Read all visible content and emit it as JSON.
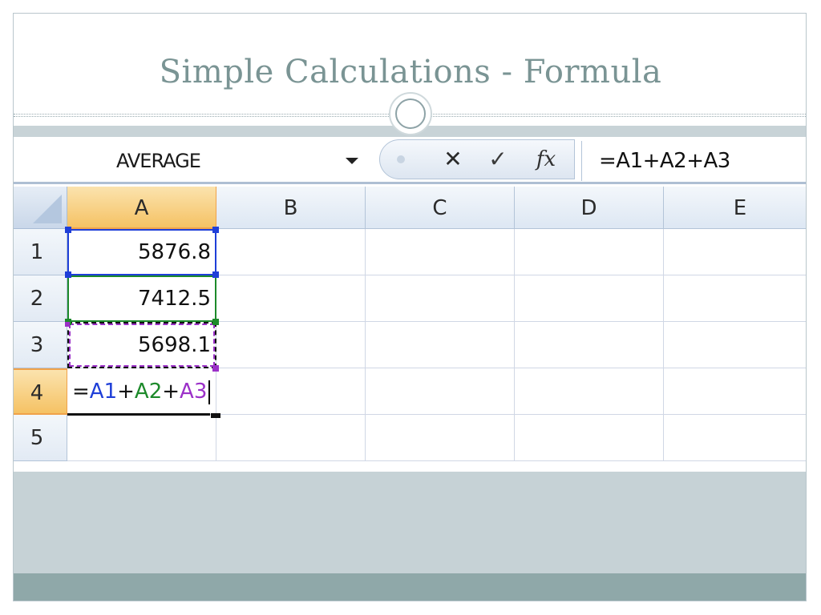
{
  "slide": {
    "title": "Simple Calculations - Formula"
  },
  "formula_bar": {
    "name_box": "AVERAGE",
    "cancel_glyph": "✕",
    "enter_glyph": "✓",
    "function_glyph": "fx",
    "formula": "=A1+A2+A3"
  },
  "columns": [
    "A",
    "B",
    "C",
    "D",
    "E"
  ],
  "rows": [
    "1",
    "2",
    "3",
    "4",
    "5"
  ],
  "cells": {
    "A1": "5876.8",
    "A2": "7412.5",
    "A3": "5698.1",
    "A4": {
      "eq": "=",
      "ref1": "A1",
      "plus1": "+",
      "ref2": "A2",
      "plus2": "+",
      "ref3": "A3"
    }
  },
  "colors": {
    "ref_A1": "#1f3fd8",
    "ref_A2": "#1d8a2b",
    "ref_A3": "#9b30c8",
    "active_header": "#f5c264",
    "title": "#7a9494"
  }
}
